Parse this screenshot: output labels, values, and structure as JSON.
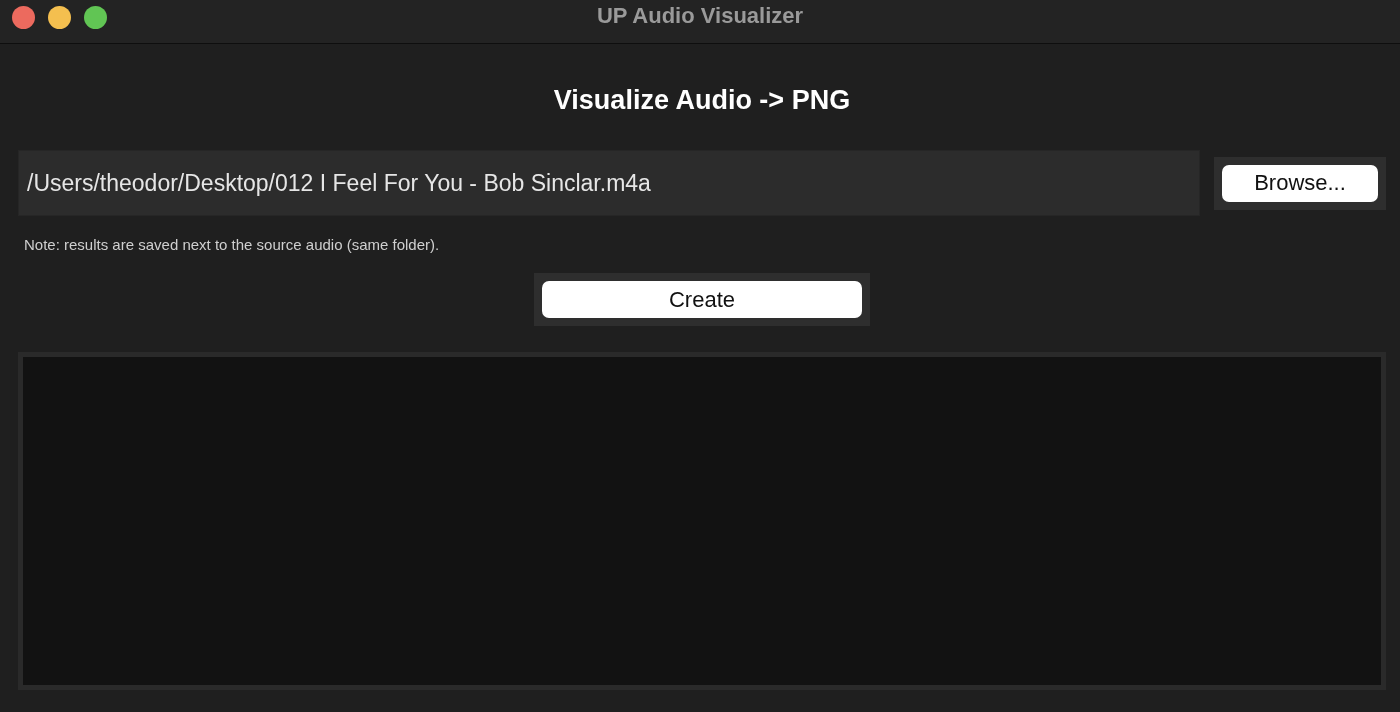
{
  "window": {
    "title": "UP Audio Visualizer"
  },
  "heading": "Visualize Audio -> PNG",
  "file_field": {
    "value": "/Users/theodor/Desktop/012 I Feel For You - Bob Sinclar.m4a"
  },
  "browse_button": "Browse...",
  "note": "Note: results are saved next to the source audio (same folder).",
  "create_button": "Create"
}
